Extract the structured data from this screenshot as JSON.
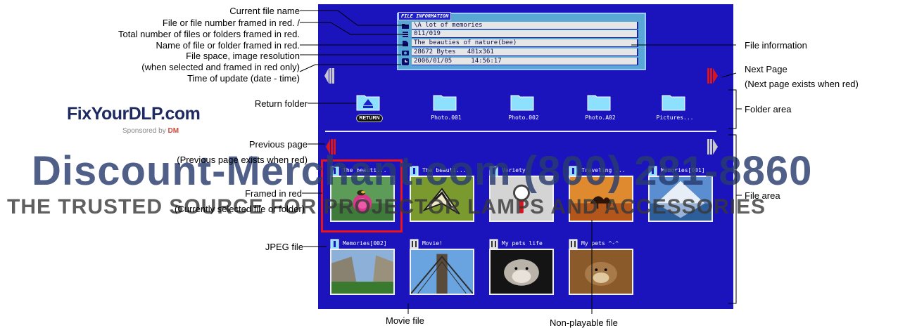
{
  "watermark": {
    "logo_main": "FixYourDLP",
    "logo_suffix": ".com",
    "sponsored": "Sponsored by",
    "sponsor_mark": "DM",
    "site": "Discount-Merchant.com (800) 281-8860",
    "tagline": "THE TRUSTED SOURCE FOR PROJECTOR LAMPS AND ACCESSORIES"
  },
  "file_information": {
    "title": "FILE INFORMATION",
    "rows": [
      {
        "icon": "folder-icon",
        "text": "\\A lot of memories"
      },
      {
        "icon": "file-count-icon",
        "text": "011/019"
      },
      {
        "icon": "file-name-icon",
        "text": "The beauties of nature(bee)"
      },
      {
        "icon": "camera-icon",
        "text": "28672 Bytes   481x361"
      },
      {
        "icon": "clock-icon",
        "text": "2006/01/05     14:56:17"
      }
    ]
  },
  "folders": [
    {
      "label": "RETURN",
      "icon": "return-folder-icon",
      "is_return": true
    },
    {
      "label": "Photo.001",
      "icon": "folder-icon"
    },
    {
      "label": "Photo.002",
      "icon": "folder-icon"
    },
    {
      "label": "Photo.A02",
      "icon": "folder-icon"
    },
    {
      "label": "Pictures...",
      "icon": "folder-icon"
    }
  ],
  "files": [
    {
      "label": "The beauti...",
      "kind": "jpeg",
      "picture": "bee-on-flower",
      "selected": true
    },
    {
      "label": "The beauti...",
      "kind": "jpeg",
      "picture": "butterfly"
    },
    {
      "label": "Variety",
      "kind": "jpeg",
      "picture": "non-playable-magnifier"
    },
    {
      "label": "Traveling ...",
      "kind": "jpeg",
      "picture": "desert-camel"
    },
    {
      "label": "Memories[001]",
      "kind": "jpeg",
      "picture": "mountain-lake"
    },
    {
      "label": "Memories[002]",
      "kind": "jpeg",
      "picture": "waterfall-valley"
    },
    {
      "label": "Movie!",
      "kind": "movie",
      "picture": "bridge"
    },
    {
      "label": "My pets life",
      "kind": "movie",
      "picture": "hamster"
    },
    {
      "label": "My pets ^-^",
      "kind": "movie",
      "picture": "hamster-2"
    }
  ],
  "navigation": {
    "previous_folder_page": "inactive",
    "next_folder_page": "active",
    "previous_file_page": "active",
    "next_file_page": "inactive"
  },
  "colors": {
    "screen": "#1b14bd",
    "info_panel": "#58a7d4",
    "active_arrow": "#d8141e",
    "inactive_arrow": "#c8c8c8",
    "selection_frame": "#e8141e"
  },
  "callouts": {
    "current_file_name": "Current file name",
    "file_number_1": "File or file number framed in red. /",
    "file_number_2": "Total number of files or folders framed in red.",
    "name_framed": "Name of file or folder framed in red.",
    "file_space_1": "File space, image resolution",
    "file_space_2": "(when selected and framed in red only)",
    "time_of_update": "Time of update (date - time)",
    "return_folder": "Return folder",
    "previous_page_1": "Previous page",
    "previous_page_2": "(Previous page exists when red)",
    "framed_in_red_1": "Framed in red",
    "framed_in_red_2": "(Currently selected file or folder)",
    "jpeg_file": "JPEG file",
    "movie_file": "Movie file",
    "non_playable_file": "Non-playable file",
    "file_information": "File information",
    "next_page_1": "Next Page",
    "next_page_2": "(Next page exists when red)",
    "folder_area": "Folder area",
    "file_area": "File area"
  }
}
